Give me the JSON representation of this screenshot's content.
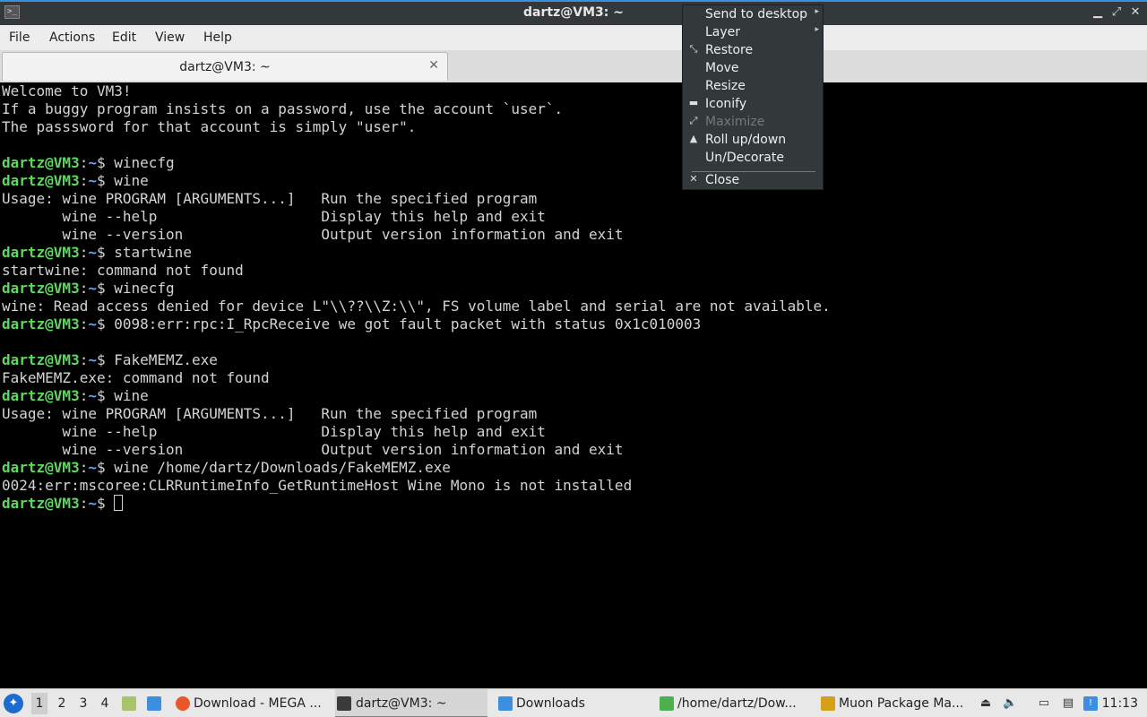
{
  "window": {
    "title": "dartz@VM3: ~",
    "app_icon": ">_",
    "controls": {
      "minimize": "▁",
      "maximize": "⤢",
      "close": "✕"
    }
  },
  "menubar": {
    "items": [
      "File",
      "Actions",
      "Edit",
      "View",
      "Help"
    ]
  },
  "tab": {
    "label": "dartz@VM3: ~",
    "close": "✕"
  },
  "prompt": {
    "user": "dartz@VM3",
    "sep": ":",
    "path": "~",
    "symbol": "$ "
  },
  "terminal": {
    "lines": [
      {
        "text": "Welcome to VM3!"
      },
      {
        "text": "If a buggy program insists on a password, use the account `user`."
      },
      {
        "text": "The passsword for that account is simply \"user\"."
      },
      {
        "text": ""
      },
      {
        "prompt": true,
        "text": "winecfg"
      },
      {
        "prompt": true,
        "text": "wine"
      },
      {
        "text": "Usage: wine PROGRAM [ARGUMENTS...]   Run the specified program"
      },
      {
        "text": "       wine --help                   Display this help and exit"
      },
      {
        "text": "       wine --version                Output version information and exit"
      },
      {
        "prompt": true,
        "text": "startwine"
      },
      {
        "text": "startwine: command not found"
      },
      {
        "prompt": true,
        "text": "winecfg"
      },
      {
        "text": "wine: Read access denied for device L\"\\\\??\\\\Z:\\\\\", FS volume label and serial are not available."
      },
      {
        "prompt": true,
        "text": "0098:err:rpc:I_RpcReceive we got fault packet with status 0x1c010003"
      },
      {
        "text": ""
      },
      {
        "prompt": true,
        "text": "FakeMEMZ.exe"
      },
      {
        "text": "FakeMEMZ.exe: command not found"
      },
      {
        "prompt": true,
        "text": "wine"
      },
      {
        "text": "Usage: wine PROGRAM [ARGUMENTS...]   Run the specified program"
      },
      {
        "text": "       wine --help                   Display this help and exit"
      },
      {
        "text": "       wine --version                Output version information and exit"
      },
      {
        "prompt": true,
        "text": "wine /home/dartz/Downloads/FakeMEMZ.exe"
      },
      {
        "text": "0024:err:mscoree:CLRRuntimeInfo_GetRuntimeHost Wine Mono is not installed"
      },
      {
        "prompt": true,
        "text": "",
        "cursor": true
      }
    ]
  },
  "context_menu": {
    "items": [
      {
        "label": "Send to desktop",
        "submenu": true,
        "icon": "",
        "disabled": false
      },
      {
        "label": "Layer",
        "submenu": true,
        "icon": "",
        "disabled": false
      },
      {
        "label": "Restore",
        "icon": "⤡",
        "icon_name": "restore-icon",
        "disabled": false
      },
      {
        "label": "Move",
        "icon": "",
        "disabled": false
      },
      {
        "label": "Resize",
        "icon": "",
        "disabled": false
      },
      {
        "label": "Iconify",
        "icon": "▬",
        "icon_name": "iconify-icon",
        "disabled": false
      },
      {
        "label": "Maximize",
        "icon": "⤢",
        "icon_name": "maximize-icon",
        "disabled": true
      },
      {
        "label": "Roll up/down",
        "icon": "▲",
        "icon_name": "rollup-icon",
        "disabled": false
      },
      {
        "label": "Un/Decorate",
        "icon": "",
        "disabled": false
      },
      {
        "label": "Close",
        "icon": "✕",
        "icon_name": "close-icon",
        "disabled": false
      }
    ],
    "submenu_arrow": "▸"
  },
  "taskbar": {
    "workspaces": [
      "1",
      "2",
      "3",
      "4"
    ],
    "active_workspace": "1",
    "tasks": [
      {
        "label": "Download - MEGA ...",
        "icon": "firefox-icon",
        "color": "#e8572a"
      },
      {
        "label": "dartz@VM3: ~",
        "icon": "terminal-icon",
        "color": "#3a3a3a",
        "active": true
      },
      {
        "label": "Downloads",
        "icon": "folder-icon",
        "color": "#3d8ee0"
      },
      {
        "label": "/home/dartz/Dow...",
        "icon": "file-manager-icon",
        "color": "#4caf50"
      },
      {
        "label": "Muon Package Ma...",
        "icon": "package-icon",
        "color": "#d4a017"
      }
    ],
    "clock": "11:13"
  },
  "colors": {
    "prompt_user": "#5fd75f",
    "prompt_path": "#6aa0ff",
    "accent": "#3d8ee0"
  }
}
